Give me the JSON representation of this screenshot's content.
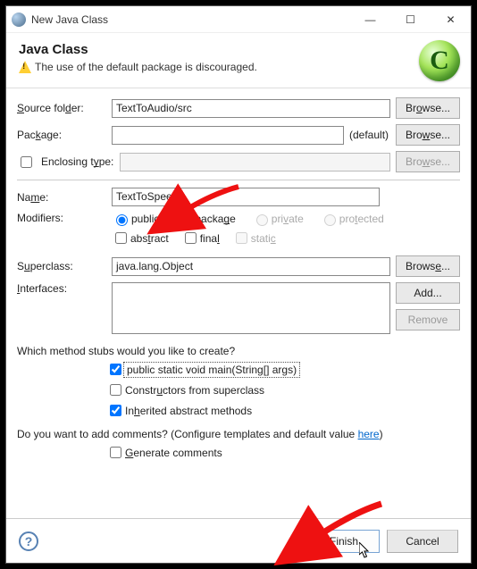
{
  "window": {
    "title": "New Java Class",
    "btn_min": "—",
    "btn_max": "☐",
    "btn_close": "✕"
  },
  "header": {
    "title": "Java Class",
    "warning": "The use of the default package is discouraged.",
    "logo_text": "C"
  },
  "labels": {
    "source_folder": "Source folder:",
    "package": "Package:",
    "package_hint": "(default)",
    "enclosing_type": "Enclosing type:",
    "name": "Name:",
    "modifiers": "Modifiers:",
    "superclass": "Superclass:",
    "interfaces": "Interfaces:",
    "stubs_q": "Which method stubs would you like to create?",
    "stub_main": "public static void main(String[] args)",
    "stub_constructors": "Constructors from superclass",
    "stub_inherited": "Inherited abstract methods",
    "comments_q": "Do you want to add comments? (Configure templates and default value ",
    "comments_link": "here",
    "comments_q_end": ")",
    "generate_comments": "Generate comments"
  },
  "values": {
    "source_folder": "TextToAudio/src",
    "package": "",
    "enclosing_type": "",
    "name": "TextToSpeech",
    "superclass": "java.lang.Object"
  },
  "modifiers": {
    "public": "public",
    "package": "package",
    "private": "private",
    "protected": "protected",
    "abstract": "abstract",
    "final": "final",
    "static": "static"
  },
  "buttons": {
    "browse": "Browse...",
    "add": "Add...",
    "remove": "Remove",
    "finish": "Finish",
    "cancel": "Cancel"
  }
}
